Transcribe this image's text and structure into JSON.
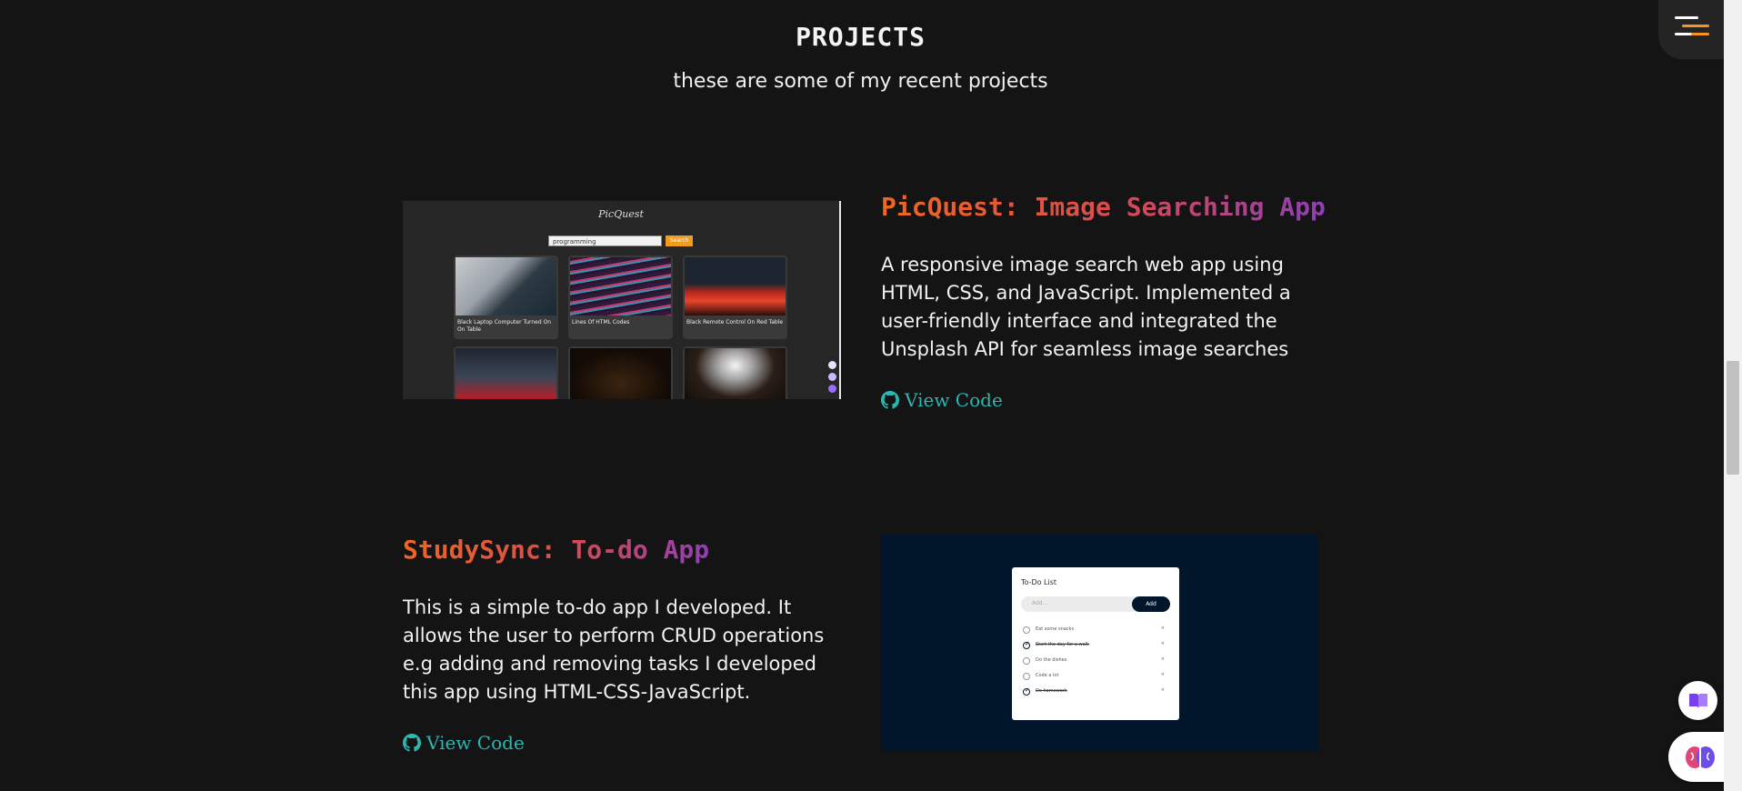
{
  "section": {
    "title": "PROJECTS",
    "subtitle": "these are some of my recent projects"
  },
  "menu": {
    "icon": "hamburger-menu-icon"
  },
  "projects": [
    {
      "title": "PicQuest: Image Searching App",
      "description": "A responsive image search web app using HTML, CSS, and JavaScript. Implemented a user-friendly interface and integrated the Unsplash API for seamless image searches",
      "link_label": "View Code",
      "link_icon": "github-icon",
      "screenshot": {
        "app_name": "PicQuest",
        "search_value": "programming",
        "search_button": "Search",
        "cards": [
          "Black Laptop Computer Turned On On Table",
          "Lines Of HTML Codes",
          "Black Remote Control On Red Table",
          "",
          "",
          ""
        ]
      }
    },
    {
      "title": "StudySync: To-do App",
      "description": "This is a simple to-do app I developed. It allows the user to perform CRUD operations e.g adding and removing tasks I developed this app using HTML-CSS-JavaScript.",
      "link_label": "View Code",
      "link_icon": "github-icon",
      "screenshot": {
        "title": "To-Do List",
        "placeholder": "Add...",
        "add_button": "Add",
        "items": [
          {
            "text": "Eat some snacks",
            "done": false
          },
          {
            "text": "Start the day for a walk",
            "done": true
          },
          {
            "text": "Do the dishes",
            "done": false
          },
          {
            "text": "Code a lot",
            "done": false
          },
          {
            "text": "Do homework",
            "done": true
          }
        ]
      }
    }
  ],
  "colors": {
    "background": "#141414",
    "accent_orange": "#f2661f",
    "accent_purple": "#8e3fb6",
    "link": "#2bb7b3"
  }
}
